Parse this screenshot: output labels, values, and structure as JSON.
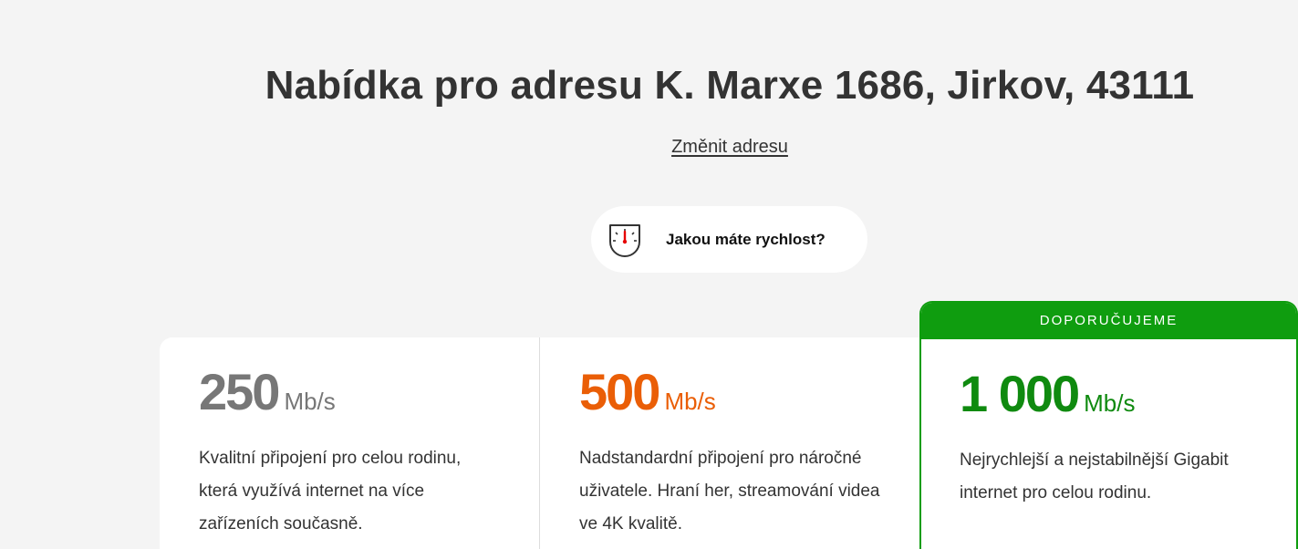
{
  "header": {
    "title": "Nabídka pro adresu K. Marxe 1686, Jirkov, 43111",
    "change_address": "Změnit adresu"
  },
  "speed_check": {
    "label": "Jakou máte rychlost?",
    "icon": "speedometer-icon"
  },
  "plans": [
    {
      "speed": "250",
      "unit": "Mb/s",
      "description": "Kvalitní připojení pro celou rodinu, která využívá internet na více zařízeních současně.",
      "color": "#777777"
    },
    {
      "speed": "500",
      "unit": "Mb/s",
      "description": "Nadstandardní připojení pro náročné uživatele. Hraní her, streamování videa ve 4K kvalitě.",
      "color": "#ea5e06"
    },
    {
      "badge": "DOPORUČUJEME",
      "speed": "1 000",
      "unit": "Mb/s",
      "description": "Nejrychlejší a nejstabilnější Gigabit internet pro celou rodinu.",
      "color": "#0f8a0f"
    }
  ],
  "colors": {
    "background": "#f4f4f4",
    "recommended": "#0f9d0f",
    "speedometer_needle": "#e60000"
  }
}
